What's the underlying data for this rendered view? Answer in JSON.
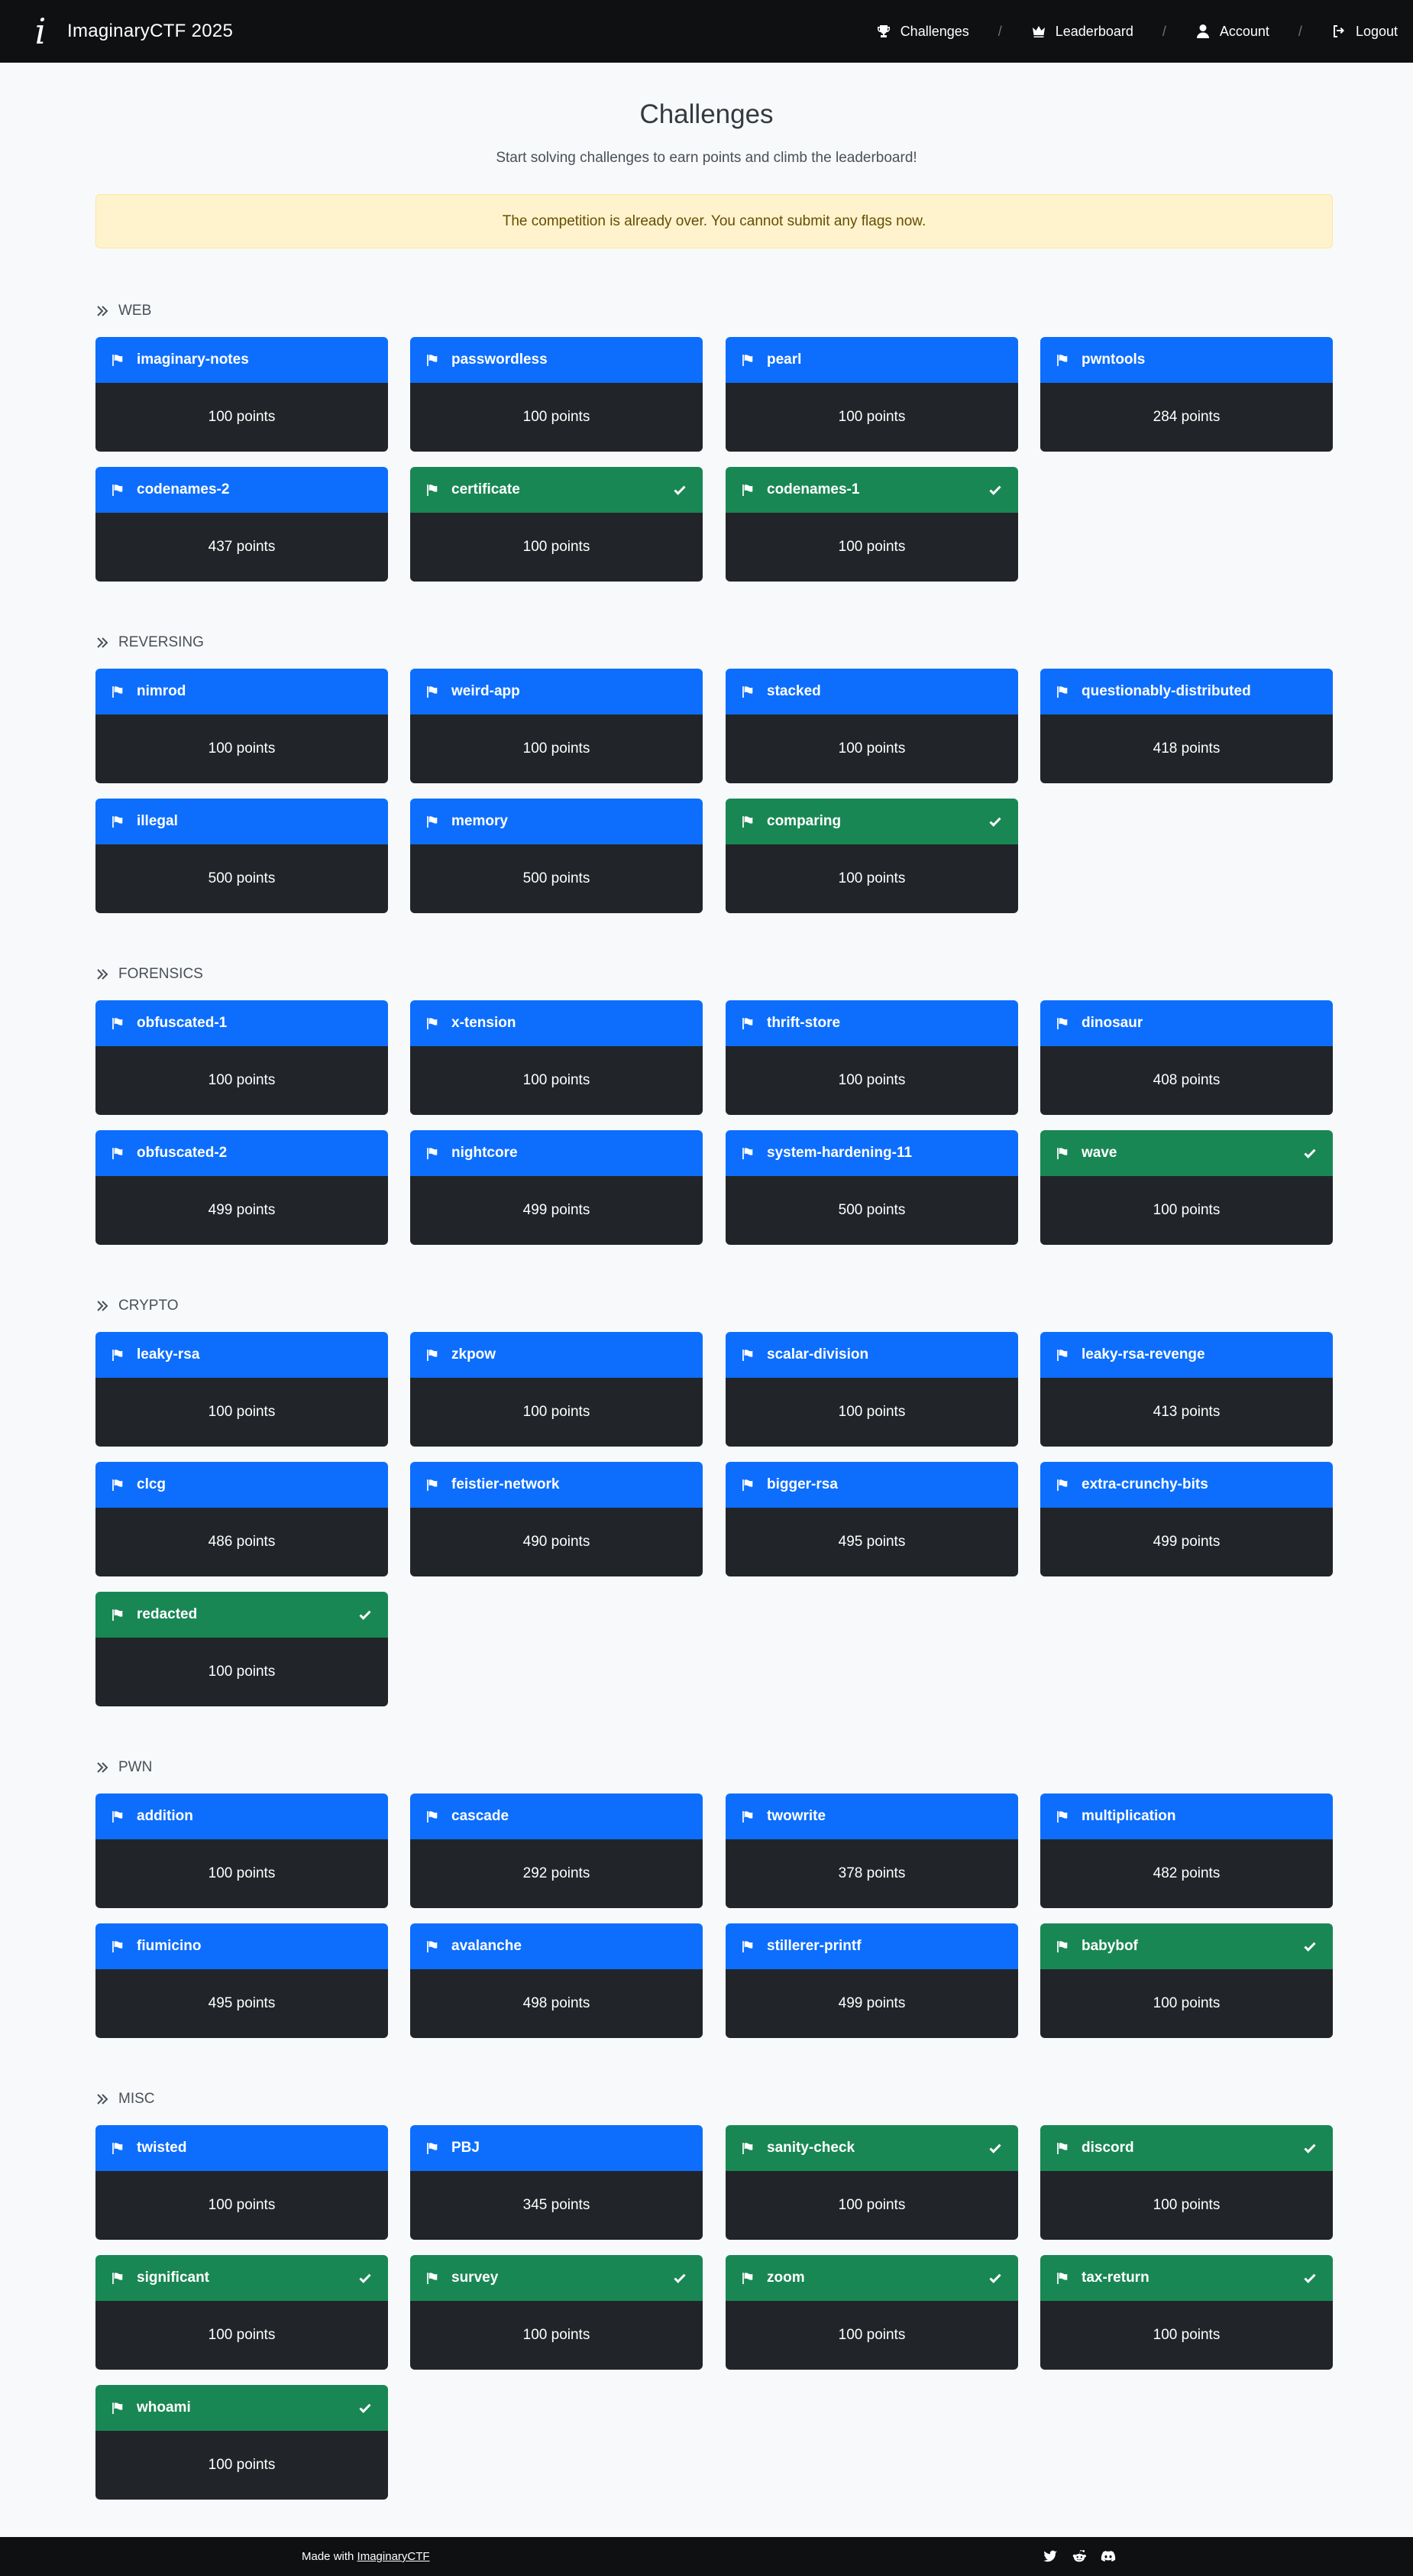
{
  "nav": {
    "brand": "ImaginaryCTF 2025",
    "brand_logo": "i",
    "items": [
      {
        "label": "Challenges",
        "icon": "trophy-icon"
      },
      {
        "label": "Leaderboard",
        "icon": "crown-icon"
      },
      {
        "label": "Account",
        "icon": "user-icon"
      },
      {
        "label": "Logout",
        "icon": "logout-icon"
      }
    ],
    "separator": "/"
  },
  "header": {
    "title": "Challenges",
    "subtitle": "Start solving challenges to earn points and climb the leaderboard!",
    "alert": "The competition is already over. You cannot submit any flags now."
  },
  "colors": {
    "unsolved": "#0d6efd",
    "solved": "#198754",
    "card_body": "#212529"
  },
  "categories": [
    {
      "name": "WEB",
      "challenges": [
        {
          "name": "imaginary-notes",
          "points": "100 points",
          "solved": false
        },
        {
          "name": "passwordless",
          "points": "100 points",
          "solved": false
        },
        {
          "name": "pearl",
          "points": "100 points",
          "solved": false
        },
        {
          "name": "pwntools",
          "points": "284 points",
          "solved": false
        },
        {
          "name": "codenames-2",
          "points": "437 points",
          "solved": false
        },
        {
          "name": "certificate",
          "points": "100 points",
          "solved": true
        },
        {
          "name": "codenames-1",
          "points": "100 points",
          "solved": true
        }
      ]
    },
    {
      "name": "REVERSING",
      "challenges": [
        {
          "name": "nimrod",
          "points": "100 points",
          "solved": false
        },
        {
          "name": "weird-app",
          "points": "100 points",
          "solved": false
        },
        {
          "name": "stacked",
          "points": "100 points",
          "solved": false
        },
        {
          "name": "questionably-distributed",
          "points": "418 points",
          "solved": false
        },
        {
          "name": "illegal",
          "points": "500 points",
          "solved": false
        },
        {
          "name": "memory",
          "points": "500 points",
          "solved": false
        },
        {
          "name": "comparing",
          "points": "100 points",
          "solved": true
        }
      ]
    },
    {
      "name": "FORENSICS",
      "challenges": [
        {
          "name": "obfuscated-1",
          "points": "100 points",
          "solved": false
        },
        {
          "name": "x-tension",
          "points": "100 points",
          "solved": false
        },
        {
          "name": "thrift-store",
          "points": "100 points",
          "solved": false
        },
        {
          "name": "dinosaur",
          "points": "408 points",
          "solved": false
        },
        {
          "name": "obfuscated-2",
          "points": "499 points",
          "solved": false
        },
        {
          "name": "nightcore",
          "points": "499 points",
          "solved": false
        },
        {
          "name": "system-hardening-11",
          "points": "500 points",
          "solved": false
        },
        {
          "name": "wave",
          "points": "100 points",
          "solved": true
        }
      ]
    },
    {
      "name": "CRYPTO",
      "challenges": [
        {
          "name": "leaky-rsa",
          "points": "100 points",
          "solved": false
        },
        {
          "name": "zkpow",
          "points": "100 points",
          "solved": false
        },
        {
          "name": "scalar-division",
          "points": "100 points",
          "solved": false
        },
        {
          "name": "leaky-rsa-revenge",
          "points": "413 points",
          "solved": false
        },
        {
          "name": "clcg",
          "points": "486 points",
          "solved": false
        },
        {
          "name": "feistier-network",
          "points": "490 points",
          "solved": false
        },
        {
          "name": "bigger-rsa",
          "points": "495 points",
          "solved": false
        },
        {
          "name": "extra-crunchy-bits",
          "points": "499 points",
          "solved": false
        },
        {
          "name": "redacted",
          "points": "100 points",
          "solved": true
        }
      ]
    },
    {
      "name": "PWN",
      "challenges": [
        {
          "name": "addition",
          "points": "100 points",
          "solved": false
        },
        {
          "name": "cascade",
          "points": "292 points",
          "solved": false
        },
        {
          "name": "twowrite",
          "points": "378 points",
          "solved": false
        },
        {
          "name": "multiplication",
          "points": "482 points",
          "solved": false
        },
        {
          "name": "fiumicino",
          "points": "495 points",
          "solved": false
        },
        {
          "name": "avalanche",
          "points": "498 points",
          "solved": false
        },
        {
          "name": "stillerer-printf",
          "points": "499 points",
          "solved": false
        },
        {
          "name": "babybof",
          "points": "100 points",
          "solved": true
        }
      ]
    },
    {
      "name": "MISC",
      "challenges": [
        {
          "name": "twisted",
          "points": "100 points",
          "solved": false
        },
        {
          "name": "PBJ",
          "points": "345 points",
          "solved": false
        },
        {
          "name": "sanity-check",
          "points": "100 points",
          "solved": true
        },
        {
          "name": "discord",
          "points": "100 points",
          "solved": true
        },
        {
          "name": "significant",
          "points": "100 points",
          "solved": true
        },
        {
          "name": "survey",
          "points": "100 points",
          "solved": true
        },
        {
          "name": "zoom",
          "points": "100 points",
          "solved": true
        },
        {
          "name": "tax-return",
          "points": "100 points",
          "solved": true
        },
        {
          "name": "whoami",
          "points": "100 points",
          "solved": true
        }
      ]
    }
  ],
  "footer": {
    "made_with": "Made with",
    "link": "ImaginaryCTF",
    "icons": [
      "twitter-icon",
      "reddit-icon",
      "discord-icon"
    ]
  }
}
